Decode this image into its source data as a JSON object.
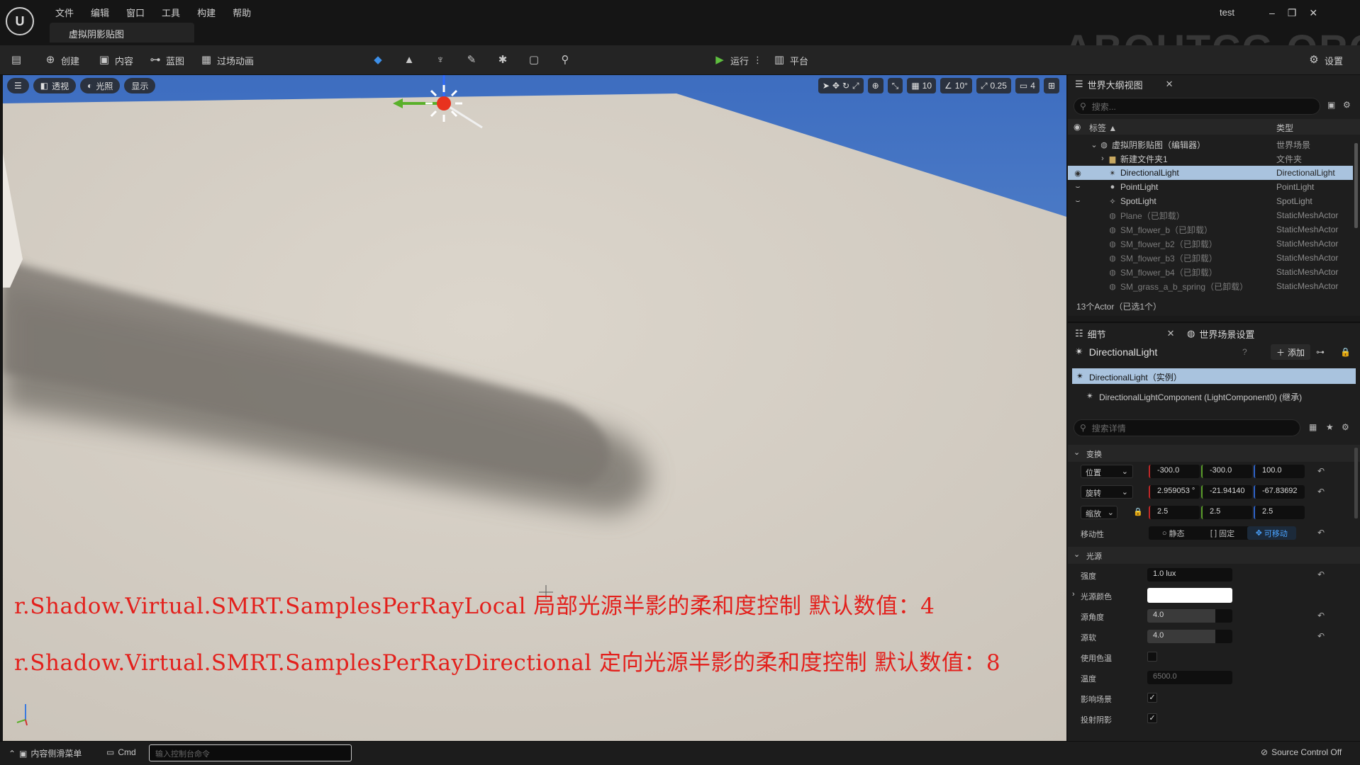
{
  "window": {
    "logo_label": "U",
    "menu": [
      "文件",
      "编辑",
      "窗口",
      "工具",
      "构建",
      "帮助"
    ],
    "level_tab": "虚拟阴影贴图",
    "project_name": "test",
    "controls": [
      "–",
      "❐",
      "✕"
    ],
    "watermark": "ABOUTCG.ORG"
  },
  "toolbar": {
    "create": "创建",
    "content": "内容",
    "blueprint": "蓝图",
    "cinematics": "过场动画",
    "play": "运行",
    "platforms": "平台",
    "settings": "设置"
  },
  "viewport": {
    "perspective": "透视",
    "lighting": "光照",
    "show": "显示",
    "grid_snap": "10",
    "rotation_snap": "10°",
    "scale_snap": "0.25",
    "camera_speed": "4",
    "overlay_line1": "r.Shadow.Virtual.SMRT.SamplesPerRayLocal 局部光源半影的柔和度控制 默认数值：4",
    "overlay_line2": "r.Shadow.Virtual.SMRT.SamplesPerRayDirectional 定向光源半影的柔和度控制 默认数值：8"
  },
  "outliner": {
    "tab_title": "世界大纲视图",
    "search_placeholder": "搜索...",
    "col_label": "标签 ▲",
    "col_type": "类型",
    "rows": [
      {
        "name": "虚拟阴影贴图（编辑器）",
        "type": "世界场景"
      },
      {
        "name": "新建文件夹1",
        "type": "文件夹"
      },
      {
        "name": "DirectionalLight",
        "type": "DirectionalLight"
      },
      {
        "name": "PointLight",
        "type": "PointLight"
      },
      {
        "name": "SpotLight",
        "type": "SpotLight"
      },
      {
        "name": "Plane（已卸载）",
        "type": "StaticMeshActor"
      },
      {
        "name": "SM_flower_b（已卸载）",
        "type": "StaticMeshActor"
      },
      {
        "name": "SM_flower_b2（已卸载）",
        "type": "StaticMeshActor"
      },
      {
        "name": "SM_flower_b3（已卸载）",
        "type": "StaticMeshActor"
      },
      {
        "name": "SM_flower_b4（已卸载）",
        "type": "StaticMeshActor"
      },
      {
        "name": "SM_grass_a_b_spring（已卸载）",
        "type": "StaticMeshActor"
      }
    ],
    "footer": "13个Actor（已选1个）"
  },
  "details": {
    "tab_title": "细节",
    "world_settings_tab": "世界场景设置",
    "actor_name": "DirectionalLight",
    "add_label": "添加",
    "instance_row": "DirectionalLight（实例）",
    "component_row": "DirectionalLightComponent (LightComponent0) (继承)",
    "search_placeholder": "搜索详情",
    "transform_section": "变换",
    "location_label": "位置",
    "location": [
      "-300.0",
      "-300.0",
      "100.0"
    ],
    "rotation_label": "旋转",
    "rotation": [
      "2.959053 °",
      "-21.94140",
      "-67.83692"
    ],
    "scale_label": "缩放",
    "scale": [
      "2.5",
      "2.5",
      "2.5"
    ],
    "mobility_label": "移动性",
    "mobility_static": "静态",
    "mobility_stationary": "固定",
    "mobility_movable": "可移动",
    "light_section": "光源",
    "intensity_label": "强度",
    "intensity": "1.0 lux",
    "light_color_label": "光源颜色",
    "source_angle_label": "源角度",
    "source_angle": "4.0",
    "source_soft_angle_label": "源软",
    "source_soft_angle": "4.0",
    "use_temperature_label": "使用色温",
    "temperature_label": "温度",
    "temperature": "6500.0",
    "affects_world_label": "影响场景",
    "cast_shadows_label": "投射阴影"
  },
  "statusbar": {
    "content_drawer": "内容侧滑菜单",
    "cmd": "Cmd",
    "console_placeholder": "输入控制台命令",
    "source_control": "Source Control Off"
  }
}
